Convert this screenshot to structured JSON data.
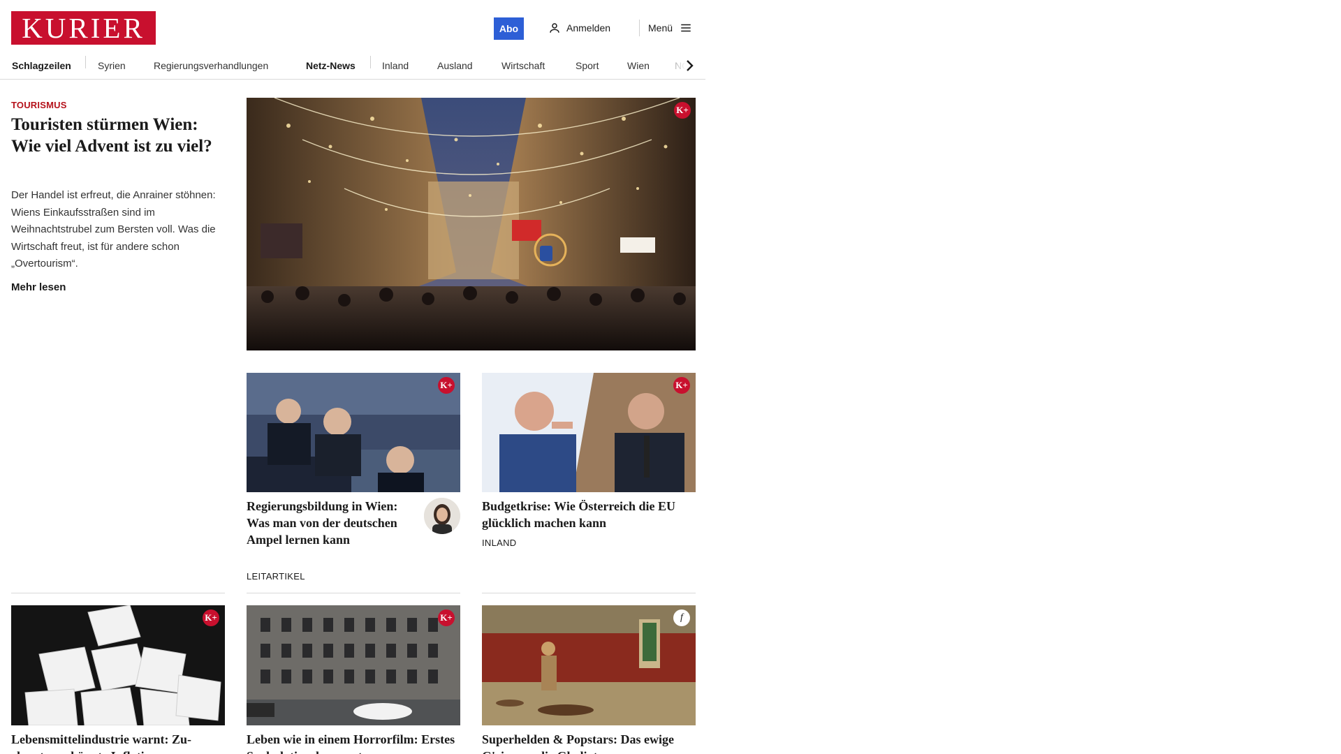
{
  "brand": {
    "logo": "KURIER",
    "color": "#c8102e"
  },
  "header": {
    "abo_label": "Abo",
    "login_label": "Anmelden",
    "menu_label": "Menü"
  },
  "nav": {
    "items": [
      "Schlagzeilen",
      "Syrien",
      "Regierungsverhandlungen",
      "Netz-News",
      "Inland",
      "Ausland",
      "Wirtschaft",
      "Sport",
      "Wien",
      "NÖ"
    ]
  },
  "lead": {
    "kicker": "TOURISMUS",
    "title": "Touristen stürmen Wien: Wie viel Advent ist zu viel?",
    "text": "Der Handel ist erfreut, die Anrainer stöhnen: Wiens Einkaufsstraßen sind im Weihnachtstrubel zum Bersten voll. Was die Wirtschaft freut, ist für andere schon „Overtourism“.",
    "more": "Mehr lesen",
    "badge": "K+"
  },
  "cards": [
    {
      "title": "Regierungsbildung in Wien: Was man von der deutschen Ampel lernen kann",
      "tag": "LEITARTIKEL",
      "badge": "K+"
    },
    {
      "title": "Budgetkrise: Wie Österreich die EU glücklich machen kann",
      "tag": "INLAND",
      "badge": "K+"
    },
    {
      "title": "Lebensmittelindustrie warnt: Zu­ckersteuer könnte Inflation",
      "badge": "K+"
    },
    {
      "title": "Leben wie in einem Horrorfilm: Erstes Spekulationshaus unter",
      "badge": "K+"
    },
    {
      "title": "Superhelden & Popstars: Das ewige G'riss um die Gladiatoren",
      "badge": "f"
    }
  ],
  "colors": {
    "accent": "#c8102e",
    "abo": "#2d5fd6",
    "kicker": "#b5121b"
  },
  "icons": {
    "login": "user-icon",
    "menu": "hamburger-icon",
    "nav_next": "chevron-right-icon"
  }
}
